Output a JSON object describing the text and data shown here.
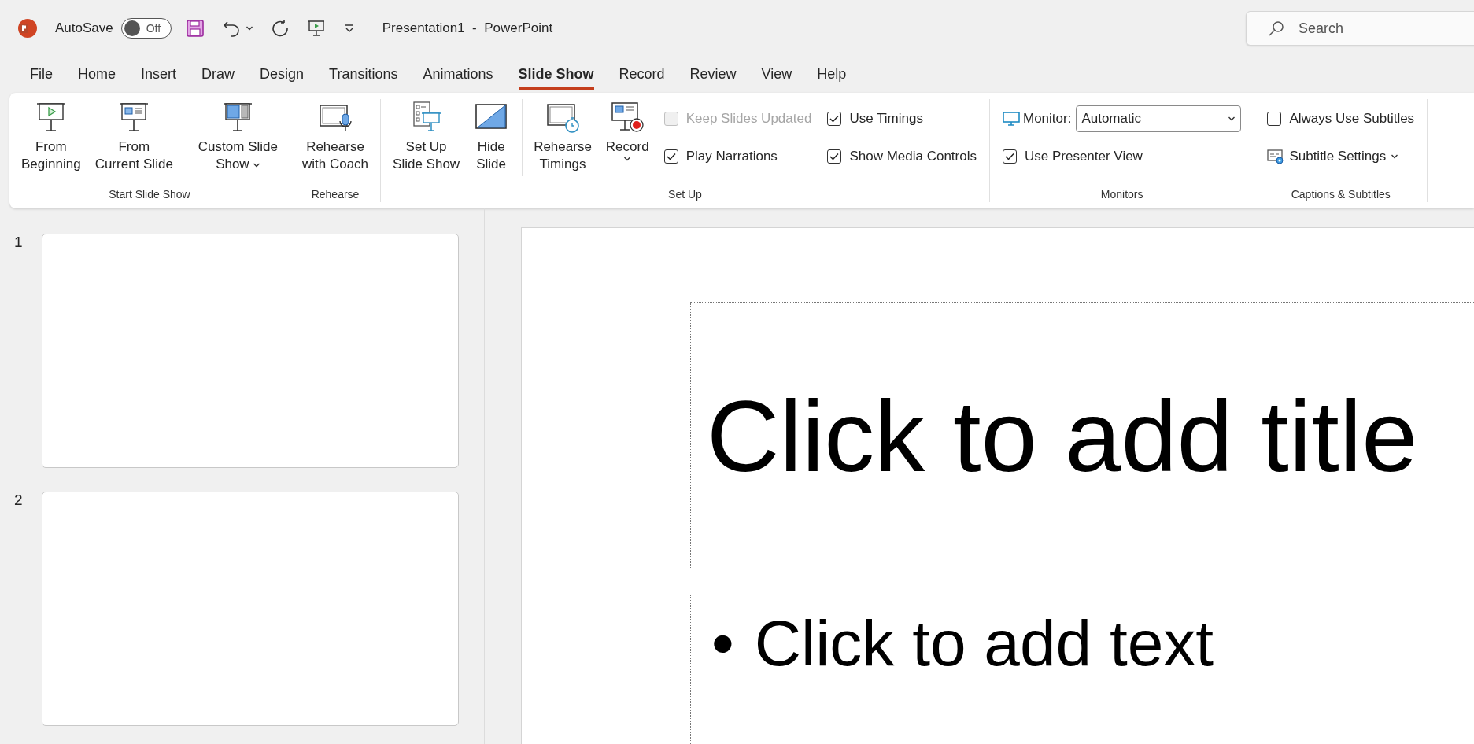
{
  "title_bar": {
    "autosave_label": "AutoSave",
    "autosave_toggle": {
      "on": false,
      "text": "Off"
    },
    "document_title": "Presentation1  -  PowerPoint",
    "search": {
      "placeholder": "Search"
    }
  },
  "tabs": [
    {
      "label": "File",
      "selected": false
    },
    {
      "label": "Home",
      "selected": false
    },
    {
      "label": "Insert",
      "selected": false
    },
    {
      "label": "Draw",
      "selected": false
    },
    {
      "label": "Design",
      "selected": false
    },
    {
      "label": "Transitions",
      "selected": false
    },
    {
      "label": "Animations",
      "selected": false
    },
    {
      "label": "Slide Show",
      "selected": true
    },
    {
      "label": "Record",
      "selected": false
    },
    {
      "label": "Review",
      "selected": false
    },
    {
      "label": "View",
      "selected": false
    },
    {
      "label": "Help",
      "selected": false
    }
  ],
  "ribbon": {
    "groups": [
      {
        "label": "Start Slide Show",
        "columns": [
          {
            "kind": "large",
            "label": "From\nBeginning",
            "dropdown": false
          },
          {
            "kind": "large",
            "label": "From\nCurrent Slide",
            "dropdown": false
          },
          {
            "kind": "large",
            "label": "Custom Slide\nShow",
            "dropdown": true,
            "divider_before": true
          }
        ]
      },
      {
        "label": "Rehearse",
        "columns": [
          {
            "kind": "large",
            "label": "Rehearse\nwith Coach",
            "dropdown": false
          }
        ]
      },
      {
        "label": "Set Up",
        "columns": [
          {
            "kind": "large",
            "label": "Set Up\nSlide Show",
            "dropdown": false
          },
          {
            "kind": "large",
            "label": "Hide\nSlide",
            "dropdown": false
          },
          {
            "kind": "large",
            "label": "Rehearse\nTimings",
            "dropdown": false,
            "divider_before": true
          },
          {
            "kind": "large",
            "label": "Record",
            "dropdown": true
          },
          {
            "kind": "stack",
            "items": [
              {
                "kind": "checkbox",
                "label": "Keep Slides Updated",
                "checked": false,
                "disabled": true
              },
              {
                "kind": "checkbox",
                "label": "Play Narrations",
                "checked": true,
                "disabled": false
              }
            ]
          },
          {
            "kind": "stack",
            "items": [
              {
                "kind": "checkbox",
                "label": "Use Timings",
                "checked": true,
                "disabled": false
              },
              {
                "kind": "checkbox",
                "label": "Show Media Controls",
                "checked": true,
                "disabled": false
              }
            ]
          }
        ]
      },
      {
        "label": "Monitors",
        "columns": [
          {
            "kind": "stack",
            "items": [
              {
                "kind": "select",
                "label": "Monitor:",
                "value": "Automatic"
              },
              {
                "kind": "checkbox",
                "label": "Use Presenter View",
                "checked": true,
                "disabled": false
              }
            ]
          }
        ]
      },
      {
        "label": "Captions & Subtitles",
        "columns": [
          {
            "kind": "stack",
            "items": [
              {
                "kind": "checkbox",
                "label": "Always Use Subtitles",
                "checked": false,
                "disabled": false
              },
              {
                "kind": "menu",
                "label": "Subtitle Settings",
                "dropdown": true
              }
            ]
          }
        ]
      }
    ]
  },
  "slides_pane": {
    "thumbnails": [
      {
        "number": "1"
      },
      {
        "number": "2"
      }
    ]
  },
  "slide": {
    "title_placeholder": "Click to add title",
    "body_placeholder": {
      "bullet": "•",
      "text": "Click to add text"
    }
  }
}
